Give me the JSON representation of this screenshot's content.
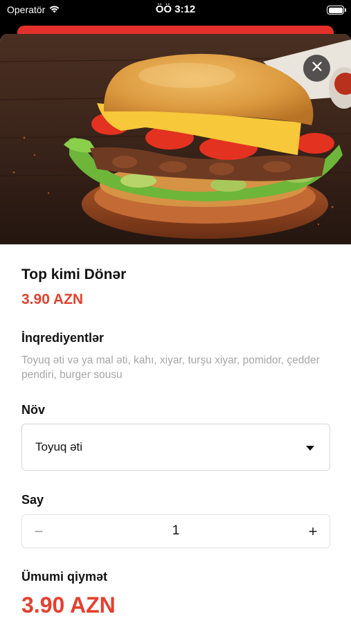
{
  "status_bar": {
    "carrier": "Operatör",
    "time": "ÖÖ 3:12",
    "battery_level": 1.0
  },
  "product": {
    "name": "Top kimi Dönər",
    "price": "3.90 AZN",
    "image_icon": "doner-burger-photo"
  },
  "ingredients": {
    "label": "İnqrediyentlər",
    "text": "Toyuq əti və ya mal əti, kahı, xiyar, turşu xiyar, pomidor, çedder pendiri, burger sousu"
  },
  "type_select": {
    "label": "Növ",
    "selected": "Toyuq əti"
  },
  "quantity": {
    "label": "Say",
    "minus": "−",
    "value": "1",
    "plus": "+"
  },
  "total": {
    "label": "Ümumi qiymət",
    "value": "3.90 AZN"
  },
  "colors": {
    "accent": "#e4402f",
    "header_sheet": "#e4302b"
  }
}
